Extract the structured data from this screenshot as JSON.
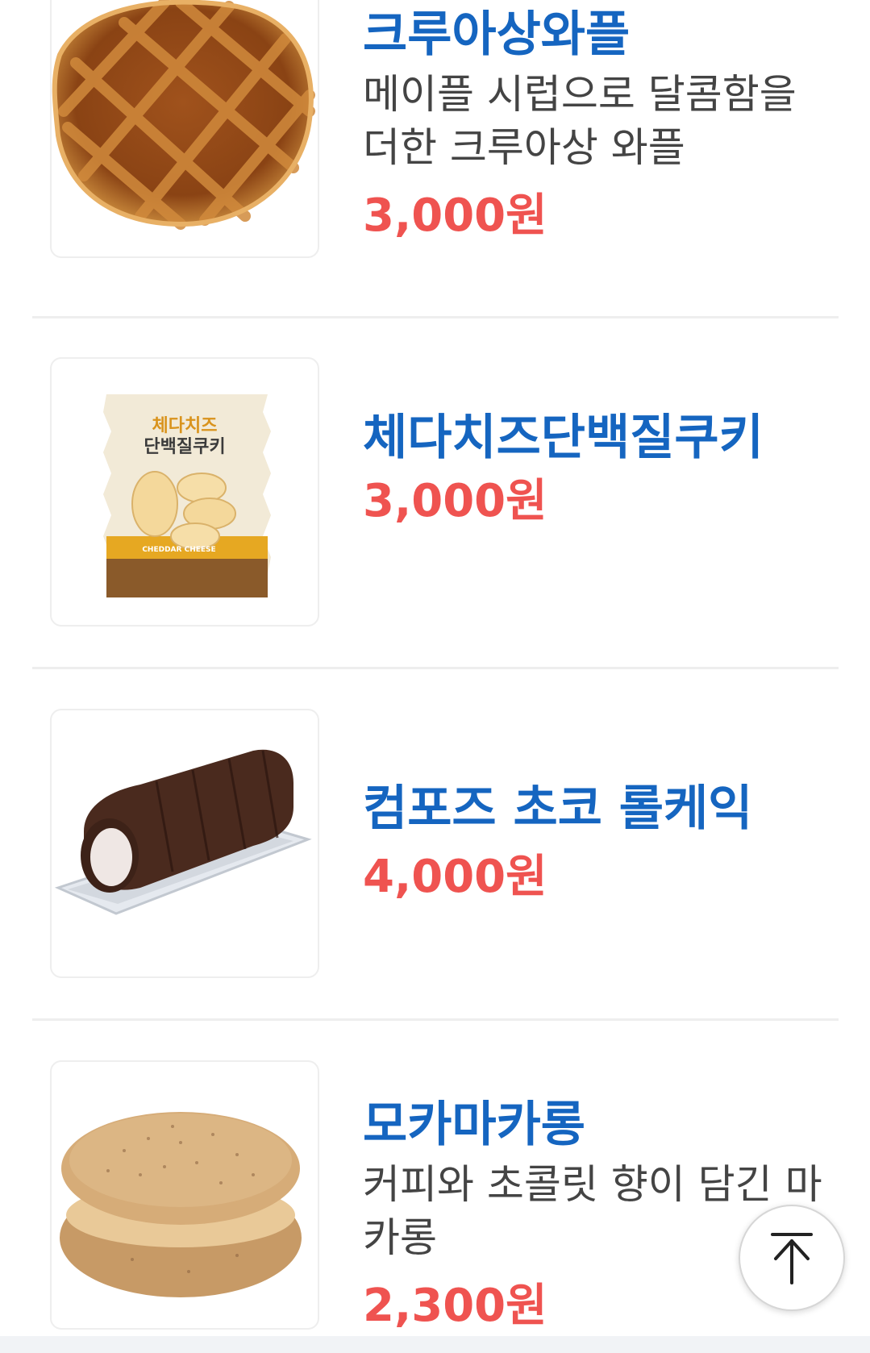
{
  "products": [
    {
      "name": "크루아상와플",
      "description": "메이플 시럽으로 달콤함을 더한 크루아상 와플",
      "price": "3,000원",
      "image_icon": "waffle-image"
    },
    {
      "name": "체다치즈단백질쿠키",
      "description": "",
      "price": "3,000원",
      "image_icon": "cookie-package-image",
      "package_text": {
        "title_line1": "체다치즈",
        "title_line2": "단백질쿠키",
        "flavor": "CHEDDAR CHEESE"
      }
    },
    {
      "name": "컴포즈 초코 롤케익",
      "description": "",
      "price": "4,000원",
      "image_icon": "roll-cake-image"
    },
    {
      "name": "모카마카롱",
      "description": "커피와 초콜릿 향이 담긴 마카롱",
      "price": "2,300원",
      "image_icon": "macaron-image"
    }
  ],
  "scroll_top_button": {
    "icon": "arrow-up-icon"
  },
  "colors": {
    "name": "#1565c0",
    "price": "#ef5350",
    "description": "#444444",
    "divider": "#eeeeee"
  }
}
